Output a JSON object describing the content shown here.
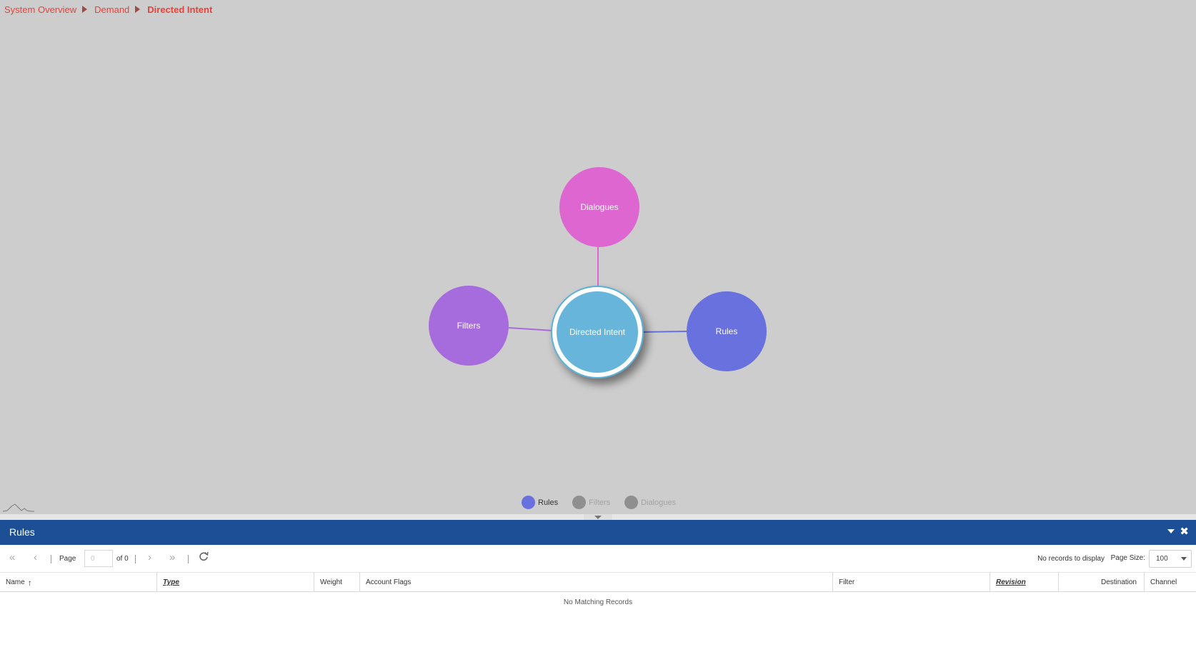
{
  "breadcrumb": [
    "System Overview",
    "Demand",
    "Directed Intent"
  ],
  "graph": {
    "center": {
      "label": "Directed Intent",
      "color": "#68b5dc"
    },
    "nodes": [
      {
        "id": "dialogues",
        "label": "Dialogues",
        "color": "#de66d0"
      },
      {
        "id": "filters",
        "label": "Filters",
        "color": "#a66bdc"
      },
      {
        "id": "rules",
        "label": "Rules",
        "color": "#6871de"
      }
    ]
  },
  "legend": [
    {
      "label": "Rules",
      "color": "#6871de",
      "active": true
    },
    {
      "label": "Filters",
      "color": "#8f8f8f",
      "active": false
    },
    {
      "label": "Dialogues",
      "color": "#8f8f8f",
      "active": false
    }
  ],
  "panel": {
    "title": "Rules"
  },
  "toolbar": {
    "page_label": "Page",
    "page_value": "0",
    "page_of": "of 0",
    "records_info": "No records to display",
    "page_size_label": "Page Size:",
    "page_size_value": "100"
  },
  "table": {
    "columns": [
      "Name",
      "Type",
      "Weight",
      "Account Flags",
      "Filter",
      "Revision",
      "Destination",
      "Channel"
    ],
    "empty_message": "No Matching Records"
  }
}
